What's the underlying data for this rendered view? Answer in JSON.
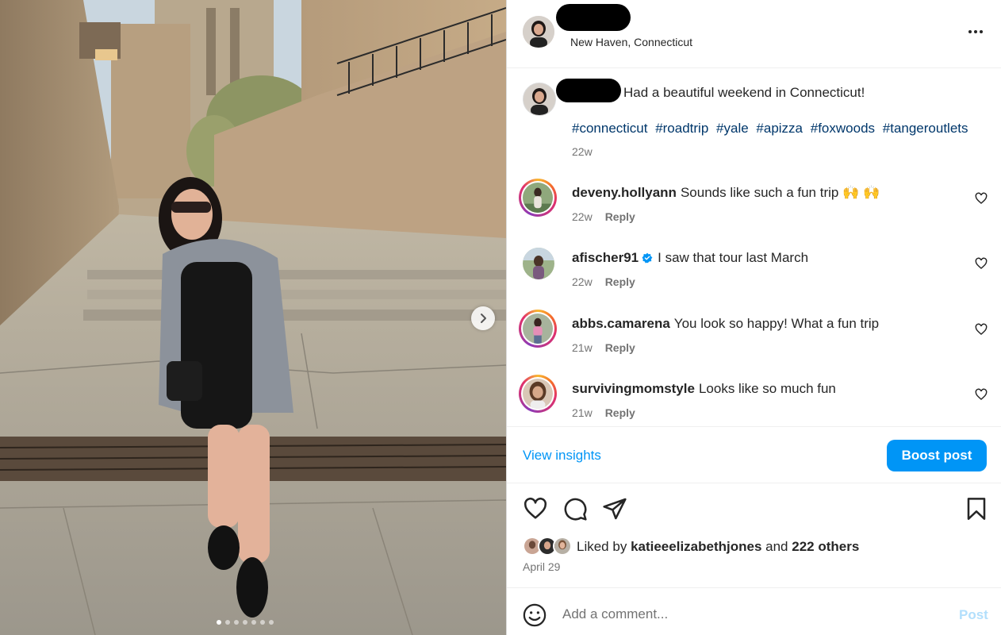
{
  "post": {
    "location": "New Haven, Connecticut",
    "caption": "Had a beautiful weekend in Connecticut!",
    "hashtags": [
      "#connecticut",
      "#roadtrip",
      "#yale",
      "#apizza",
      "#foxwoods",
      "#tangeroutlets"
    ],
    "time": "22w",
    "carousel": {
      "slides": 7,
      "current": 1
    }
  },
  "comments": [
    {
      "username": "deveny.hollyann",
      "text": "Sounds like such a fun trip 🙌 🙌",
      "time": "22w",
      "reply": "Reply",
      "verified": false,
      "story_ring": true
    },
    {
      "username": "afischer91",
      "text": "I saw that tour last March",
      "time": "22w",
      "reply": "Reply",
      "verified": true,
      "story_ring": false
    },
    {
      "username": "abbs.camarena",
      "text": "You look so happy! What a fun trip",
      "time": "21w",
      "reply": "Reply",
      "verified": false,
      "story_ring": true
    },
    {
      "username": "survivingmomstyle",
      "text": "Looks like so much fun",
      "time": "21w",
      "reply": "Reply",
      "verified": false,
      "story_ring": true
    }
  ],
  "actions": {
    "view_insights": "View insights",
    "boost_post": "Boost post"
  },
  "likes": {
    "prefix": "Liked by",
    "user": "katieeelizabethjones",
    "joiner": "and",
    "others": "222 others",
    "date": "April 29"
  },
  "comment_box": {
    "placeholder": "Add a comment...",
    "post_label": "Post"
  },
  "colors": {
    "link_blue": "#0095f6",
    "hashtag": "#00376b",
    "muted": "#737373",
    "post_disabled": "#b2dffc",
    "verified": "#0095f6"
  },
  "icons": [
    "more-icon",
    "heart-icon",
    "comment-icon",
    "share-icon",
    "bookmark-icon",
    "emoji-icon",
    "verified-icon",
    "chevron-right-icon"
  ]
}
